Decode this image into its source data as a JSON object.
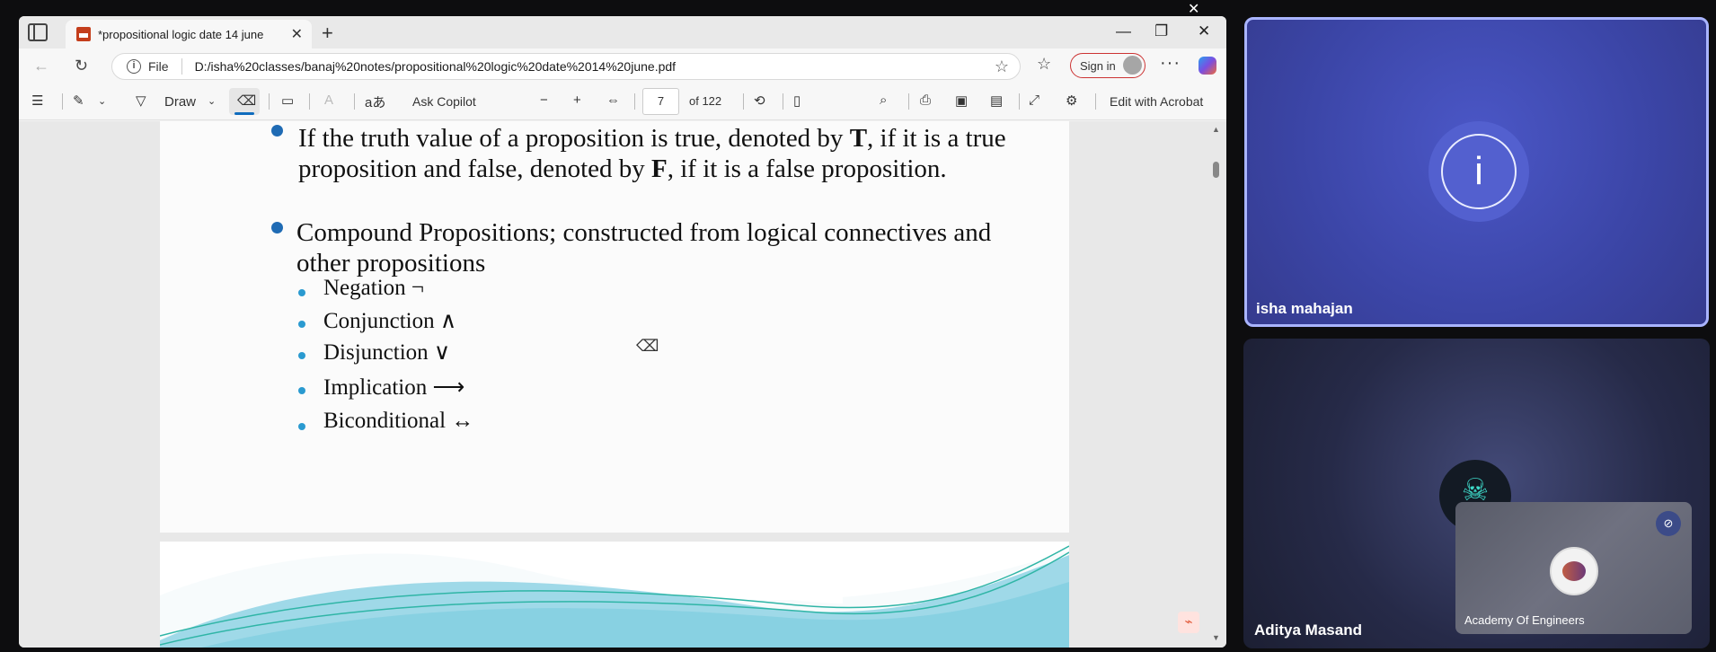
{
  "browser": {
    "tab_title": "*propositional logic date 14 june",
    "address_file_label": "File",
    "url": "D:/isha%20classes/banaj%20notes/propositional%20logic%20date%2014%20june.pdf",
    "signin_label": "Sign in"
  },
  "pdf_toolbar": {
    "draw_label": "Draw",
    "read_aloud_label": "aあ",
    "ask_copilot_label": "Ask Copilot",
    "page_current": "7",
    "page_total": "of 122",
    "edit_acrobat_label": "Edit with Acrobat"
  },
  "slide": {
    "bullet1_part1": "If the truth value of a proposition is true, denoted by ",
    "bullet1_T": "T",
    "bullet1_part2": ", if it is a true proposition and false, denoted by ",
    "bullet1_F": "F",
    "bullet1_part3": ", if it is a false proposition.",
    "bullet2": "Compound Propositions; constructed from logical connectives and other propositions",
    "sub_items": [
      "Negation ¬",
      "Conjunction ∧",
      "Disjunction ∨",
      "Implication ⟶",
      "Biconditional ↔"
    ]
  },
  "meeting": {
    "participant1_name": "isha mahajan",
    "participant1_initial": "i",
    "participant2_name": "Aditya Masand",
    "selfview_name": "Academy Of Engineers"
  },
  "colors": {
    "main_bullet": "#1f6bb4",
    "sub_bullet": "#2a9ad0",
    "active_tile_border": "#a9b4ff"
  }
}
